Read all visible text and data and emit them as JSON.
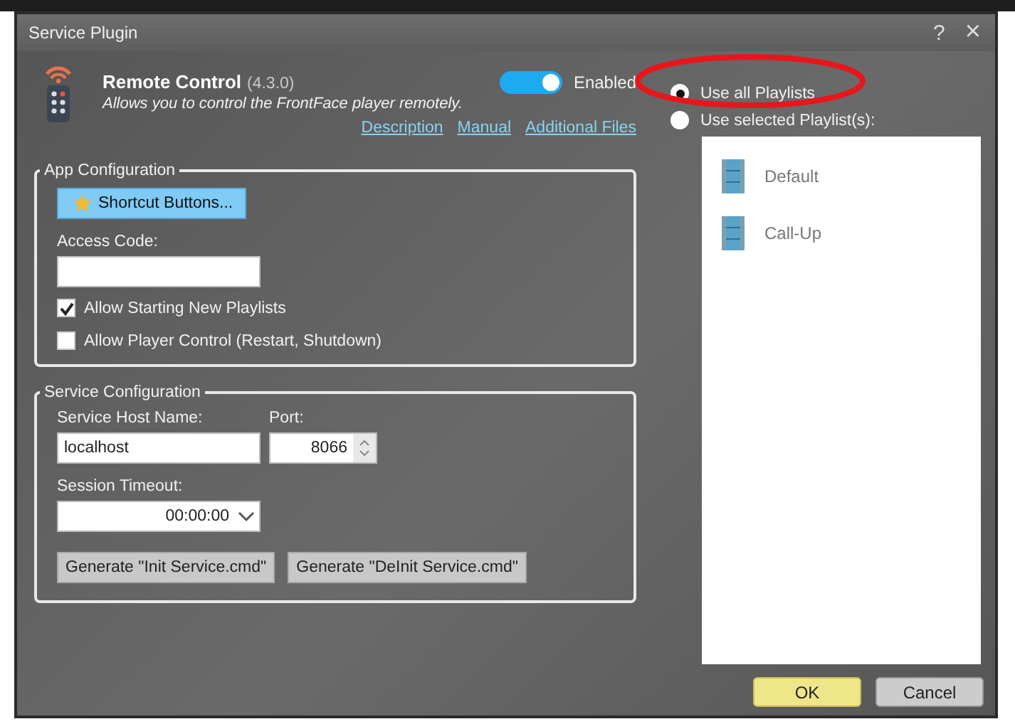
{
  "window": {
    "title": "Service Plugin",
    "help": "?",
    "close": "×"
  },
  "plugin": {
    "name": "Remote Control",
    "version": "(4.3.0)",
    "description": "Allows you to control the FrontFace player remotely.",
    "links": [
      "Description",
      "Manual",
      "Additional Files"
    ],
    "toggle": {
      "label": "Enabled",
      "on": true
    }
  },
  "app_config": {
    "title": "App Configuration",
    "shortcut_button": "Shortcut Buttons...",
    "access_code": {
      "label": "Access Code:"
    },
    "checkboxes": [
      {
        "label": "Allow Starting New Playlists",
        "checked": true
      },
      {
        "label": "Allow Player Control (Restart, Shutdown)",
        "checked": false
      }
    ]
  },
  "service_config": {
    "title": "Service Configuration",
    "host": {
      "label": "Service Host Name:",
      "value": "localhost"
    },
    "port": {
      "label": "Port:",
      "value": "8066"
    },
    "timeout": {
      "label": "Session Timeout:",
      "value": "00:00:00"
    },
    "buttons": [
      "Generate \"Init Service.cmd\"",
      "Generate \"DeInit Service.cmd\""
    ]
  },
  "playlist_mode": [
    {
      "label": "Use all Playlists",
      "selected": true
    },
    {
      "label": "Use selected Playlist(s):",
      "selected": false
    }
  ],
  "playlists": [
    {
      "name": "Default"
    },
    {
      "name": "Call-Up"
    }
  ],
  "footer_buttons": [
    {
      "label": "OK",
      "kind": "primary"
    },
    {
      "label": "Cancel",
      "kind": "secondary"
    }
  ]
}
